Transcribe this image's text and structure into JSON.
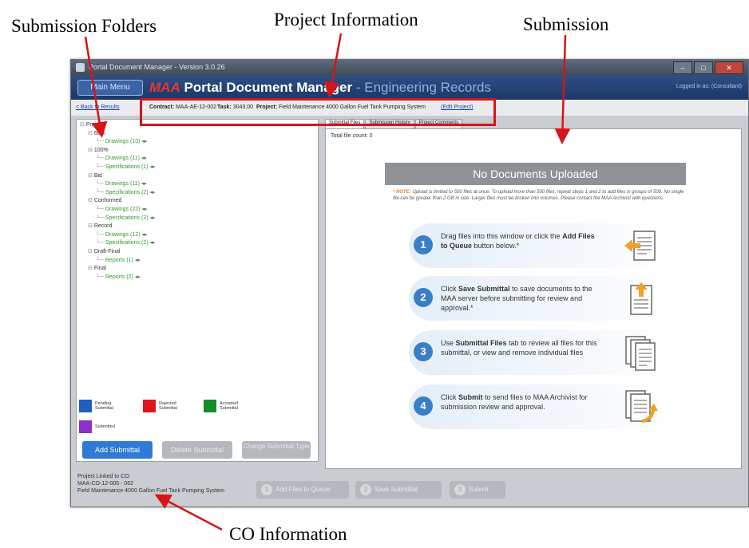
{
  "annotations": {
    "submission_folders": "Submission Folders",
    "project_information": "Project Information",
    "submission": "Submission",
    "co_information": "CO Information"
  },
  "window": {
    "title": "Portal Document Manager - Version 3.0.26",
    "controls": [
      "–",
      "□",
      "✕"
    ]
  },
  "header": {
    "main_menu": "Main Menu",
    "logo": "MAA",
    "title": "Portal Document Manager",
    "subtitle": "- Engineering Records",
    "logged_in": "Logged in as: (Consultant)"
  },
  "infobar": {
    "back": "< Back to Results",
    "contract_label": "Contract:",
    "contract_value": "MAA-AE-12-002",
    "task_label": "Task:",
    "task_value": "3043.00",
    "project_label": "Project:",
    "project_value": "Field Maintenance 4000 Gallon Fuel Tank Pumping System",
    "edit_project": "(Edit Project)"
  },
  "tree": [
    {
      "label": "Project",
      "level": 0,
      "type": "folder"
    },
    {
      "label": "60%",
      "level": 1,
      "type": "folder"
    },
    {
      "label": "Drawings (10)",
      "level": 2,
      "type": "file"
    },
    {
      "label": "100%",
      "level": 1,
      "type": "folder"
    },
    {
      "label": "Drawings (11)",
      "level": 2,
      "type": "file"
    },
    {
      "label": "Specifications (1)",
      "level": 2,
      "type": "file"
    },
    {
      "label": "Bid",
      "level": 1,
      "type": "folder"
    },
    {
      "label": "Drawings (11)",
      "level": 2,
      "type": "file"
    },
    {
      "label": "Specifications (2)",
      "level": 2,
      "type": "file"
    },
    {
      "label": "Conformed",
      "level": 1,
      "type": "folder"
    },
    {
      "label": "Drawings (22)",
      "level": 2,
      "type": "file"
    },
    {
      "label": "Specifications (2)",
      "level": 2,
      "type": "file"
    },
    {
      "label": "Record",
      "level": 1,
      "type": "folder"
    },
    {
      "label": "Drawings (12)",
      "level": 2,
      "type": "file"
    },
    {
      "label": "Specifications (2)",
      "level": 2,
      "type": "file"
    },
    {
      "label": "Draft-Final",
      "level": 1,
      "type": "folder"
    },
    {
      "label": "Reports (1)",
      "level": 2,
      "type": "file"
    },
    {
      "label": "Final",
      "level": 1,
      "type": "folder"
    },
    {
      "label": "Reports (2)",
      "level": 2,
      "type": "file"
    }
  ],
  "legend": [
    {
      "label": "Pending Submittal",
      "color": "#1f5fbf"
    },
    {
      "label": "Rejected Submittal",
      "color": "#e0141b"
    },
    {
      "label": "Accepted Submittal",
      "color": "#178a2c"
    },
    {
      "label": "Submitted",
      "color": "#8e2fc9"
    }
  ],
  "left_buttons": {
    "add": "Add Submittal",
    "delete": "Delete Submittal",
    "change": "Change Submittal Type"
  },
  "tabs": [
    "Submittal Files",
    "Submission History",
    "Project Comments"
  ],
  "main": {
    "file_count": "Total file count: 0",
    "no_docs": "No Documents Uploaded",
    "note_label": "* NOTE:",
    "note_text": "Upload is limited to 500 files at once. To upload more than 500 files, repeat steps 1 and 2 to add files in groups of 500. No single file can be greater than 2 GB in size. Larger files must be broken into volumes. Please contact the MAA Archivist with questions."
  },
  "steps": [
    {
      "num": "1",
      "pre": "Drag files into this window or click the",
      "bold": "Add Files to Queue",
      "post": "button below.*"
    },
    {
      "num": "2",
      "pre": "Click",
      "bold": "Save Submittal",
      "post": "to save documents to the MAA server before submitting for review and approval.*"
    },
    {
      "num": "3",
      "pre": "Use",
      "bold": "Submittal Files",
      "post": "tab to review all files for this submittal, or view and remove individual files"
    },
    {
      "num": "4",
      "pre": "Click",
      "bold": "Submit",
      "post": "to send files to MAA Archivist for submission review and approval."
    }
  ],
  "co": {
    "label": "Project Linked to CO:",
    "number": "MAA-CO-12-005 - 062",
    "name": "Field Maintenance 4000 Gallon Fuel Tank Pumping System"
  },
  "bottom_buttons": [
    {
      "num": "1",
      "label": "Add Files to Queue"
    },
    {
      "num": "2",
      "label": "Save Submittal"
    },
    {
      "num": "3",
      "label": "Submit"
    }
  ],
  "colors": {
    "accent_red": "#d7141a",
    "header_blue": "#1d3766",
    "step_blue": "#3a7fc6",
    "arrow_orange": "#f0a02a"
  }
}
